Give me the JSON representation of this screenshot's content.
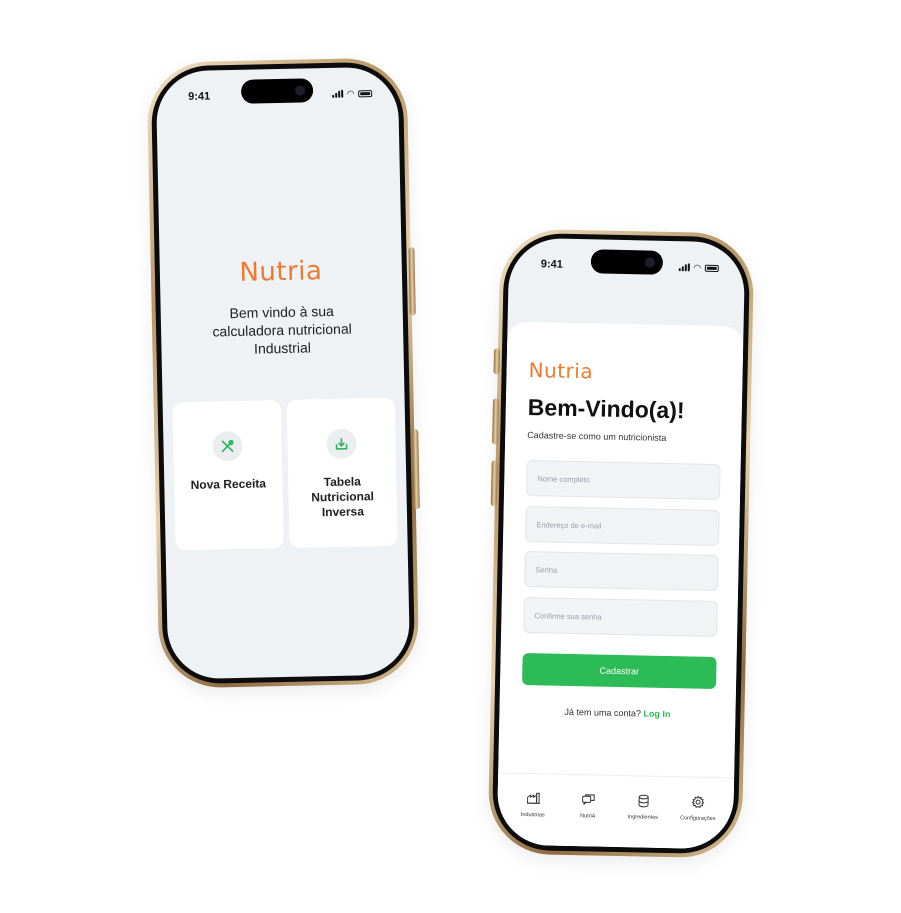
{
  "phone_home": {
    "status": {
      "time": "9:41"
    },
    "logo": "Nutria",
    "welcome": "Bem vindo à sua\ncalculadora nutricional\nIndustrial",
    "cards": [
      {
        "label": "Nova Receita",
        "icon": "utensils-icon"
      },
      {
        "label": "Tabela\nNutricional\nInversa",
        "icon": "download-tray-icon"
      }
    ]
  },
  "phone_signup": {
    "status": {
      "time": "9:41"
    },
    "logo": "Nutria",
    "title": "Bem-Vindo(a)!",
    "subtitle": "Cadastre-se como um nutricionista",
    "fields": {
      "name_placeholder": "Nome completo",
      "email_placeholder": "Endereço de e-mail",
      "password_placeholder": "Senha",
      "confirm_placeholder": "Confirme sua senha"
    },
    "submit_label": "Cadastrar",
    "login_prompt": "Já tem uma conta?",
    "login_link": "Log In",
    "tabs": [
      {
        "label": "Industrias",
        "icon": "factory-icon"
      },
      {
        "label": "NutriA",
        "icon": "chat-icon"
      },
      {
        "label": "Ingredientes",
        "icon": "database-icon"
      },
      {
        "label": "Configurações",
        "icon": "gear-icon"
      }
    ]
  },
  "colors": {
    "brand_orange": "#ef7a2e",
    "accent_green": "#2dbb57",
    "screen_bg": "#eef2f5",
    "frame_gold": "#b99665"
  }
}
